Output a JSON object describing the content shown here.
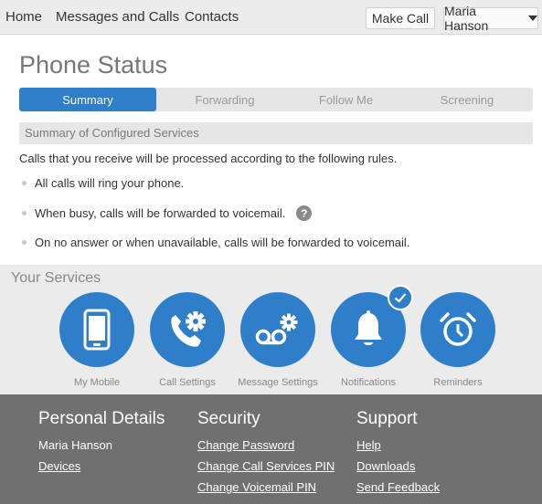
{
  "topnav": {
    "home": "Home",
    "messages": "Messages and Calls",
    "contacts": "Contacts",
    "make_call": "Make Call",
    "user_name": "Maria Hanson"
  },
  "page": {
    "title": "Phone Status",
    "tabs": [
      "Summary",
      "Forwarding",
      "Follow Me",
      "Screening"
    ],
    "active_tab": "Summary",
    "summary_header": "Summary of Configured Services",
    "intro": "Calls that you receive will be processed according to the following rules.",
    "rules": [
      "All calls will ring your phone.",
      "When busy, calls will be forwarded to voicemail.",
      "On no answer or when unavailable, calls will be forwarded to voicemail."
    ],
    "help_glyph": "?"
  },
  "services": {
    "title": "Your Services",
    "items": [
      {
        "label": "My Mobile",
        "icon": "mobile-phone-icon"
      },
      {
        "label": "Call Settings",
        "icon": "phone-gear-icon"
      },
      {
        "label": "Message Settings",
        "icon": "voicemail-gear-icon"
      },
      {
        "label": "Notifications",
        "icon": "bell-icon",
        "checked": true
      },
      {
        "label": "Reminders",
        "icon": "alarm-clock-icon"
      }
    ]
  },
  "footer": {
    "personal": {
      "title": "Personal Details",
      "name": "Maria Hanson",
      "devices": "Devices"
    },
    "security": {
      "title": "Security",
      "links": [
        "Change Password",
        "Change Call Services PIN",
        "Change Voicemail PIN"
      ]
    },
    "support": {
      "title": "Support",
      "links": [
        "Help",
        "Downloads",
        "Send Feedback"
      ]
    }
  },
  "colors": {
    "accent": "#2e7ec9",
    "nav_bg": "#ececec",
    "services_bg": "#ebebeb",
    "footer_bg": "#707070"
  }
}
